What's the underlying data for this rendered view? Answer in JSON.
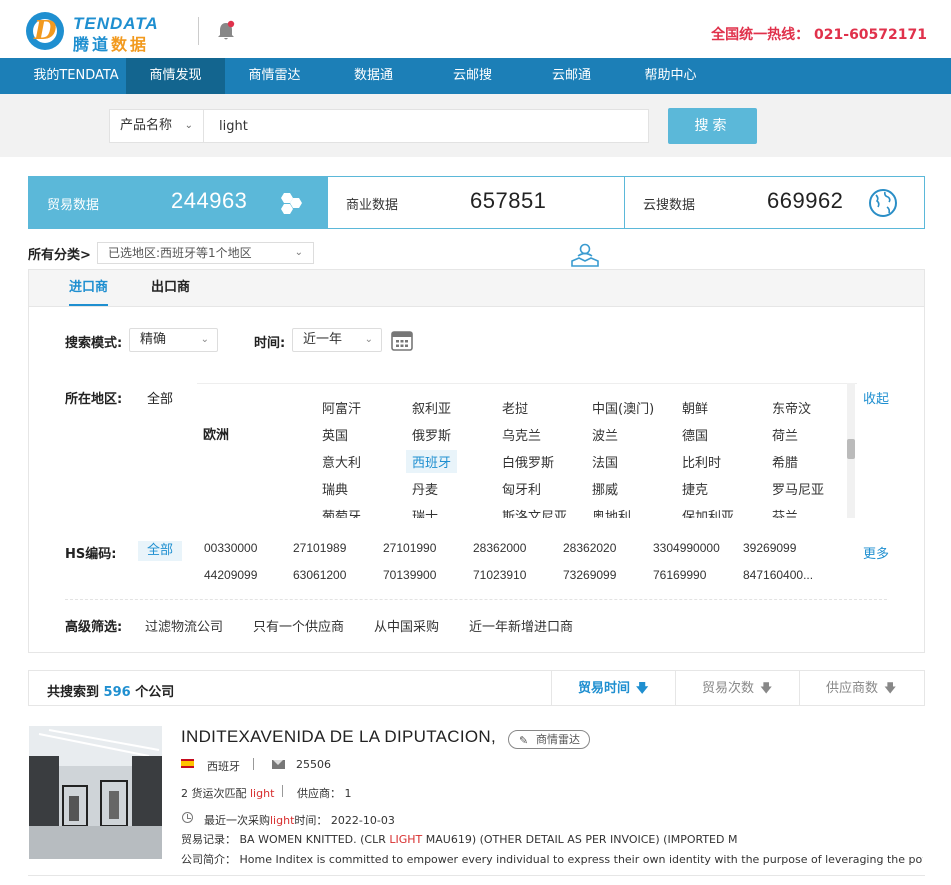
{
  "header": {
    "logo_en": "TENDATA",
    "logo_cn_1": "腾道",
    "logo_cn_2": "数据",
    "hotline": "全国统一热线： 021-60572171"
  },
  "nav": {
    "items": [
      {
        "label": "我的TENDATA"
      },
      {
        "label": "商情发现"
      },
      {
        "label": "商情雷达"
      },
      {
        "label": "数据通"
      },
      {
        "label": "云邮搜"
      },
      {
        "label": "云邮通"
      },
      {
        "label": "帮助中心"
      }
    ],
    "active_index": 1
  },
  "search": {
    "field_label": "产品名称",
    "value": "light",
    "button": "搜索"
  },
  "stats": [
    {
      "label": "贸易数据",
      "value": "244963",
      "icon": "hexagon-icon"
    },
    {
      "label": "商业数据",
      "value": "657851",
      "icon": ""
    },
    {
      "label": "云搜数据",
      "value": "669962",
      "icon": "globe-icon"
    }
  ],
  "category": {
    "label": "所有分类>",
    "region_select": "已选地区:西班牙等1个地区"
  },
  "tabs": [
    {
      "label": "进口商"
    },
    {
      "label": "出口商"
    }
  ],
  "filters": {
    "mode_label": "搜索模式:",
    "mode_value": "精确",
    "time_label": "时间:",
    "time_value": "近一年",
    "region_label": "所在地区:",
    "region_all": "全部",
    "region_continent": "欧洲",
    "region_collapse": "收起",
    "regions": [
      [
        "阿富汗",
        "叙利亚",
        "老挝",
        "中国(澳门)",
        "朝鲜",
        "东帝汶"
      ],
      [
        "英国",
        "俄罗斯",
        "乌克兰",
        "波兰",
        "德国",
        "荷兰"
      ],
      [
        "意大利",
        "西班牙",
        "白俄罗斯",
        "法国",
        "比利时",
        "希腊"
      ],
      [
        "瑞典",
        "丹麦",
        "匈牙利",
        "挪威",
        "捷克",
        "罗马尼亚"
      ],
      [
        "葡萄牙",
        "瑞士",
        "斯洛文尼亚",
        "奥地利",
        "保加利亚",
        "芬兰"
      ]
    ],
    "selected_region": "西班牙",
    "hs_label": "HS编码:",
    "hs_all": "全部",
    "hs_more": "更多",
    "hs_codes": [
      [
        "00330000",
        "27101989",
        "27101990",
        "28362000",
        "28362020",
        "3304990000",
        "39269099"
      ],
      [
        "44209099",
        "63061200",
        "70139900",
        "71023910",
        "73269099",
        "76169990",
        "847160400..."
      ]
    ],
    "adv_label": "高级筛选:",
    "adv_items": [
      "过滤物流公司",
      "只有一个供应商",
      "从中国采购",
      "近一年新增进口商"
    ]
  },
  "results": {
    "prefix": "共搜索到",
    "count": "596",
    "suffix": "个公司",
    "sorts": [
      {
        "label": "贸易时间",
        "active": true
      },
      {
        "label": "贸易次数",
        "active": false
      },
      {
        "label": "供应商数",
        "active": false
      }
    ]
  },
  "company": {
    "name": "INDITEXAVENIDA DE LA DIPUTACION,",
    "badge": "商情雷达",
    "country": "西班牙",
    "postal": "25506",
    "match_prefix": "2 货运次匹配",
    "match_kw": "light",
    "suppliers": "供应商： 1",
    "recent_prefix": "最近一次采购",
    "recent_kw": "light",
    "recent_suffix": "时间： 2022-10-03",
    "record_label": "贸易记录：",
    "record_pre": "BA WOMEN KNITTED. (CLR",
    "record_kw": "LIGHT",
    "record_post": "MAU619) (OTHER DETAIL AS PER INVOICE) (IMPORTED M",
    "intro_label": "公司简介：",
    "intro": "Home Inditex is committed to empower every individual to express their own identity with the purpose of leveraging the power of fashion to ..."
  }
}
